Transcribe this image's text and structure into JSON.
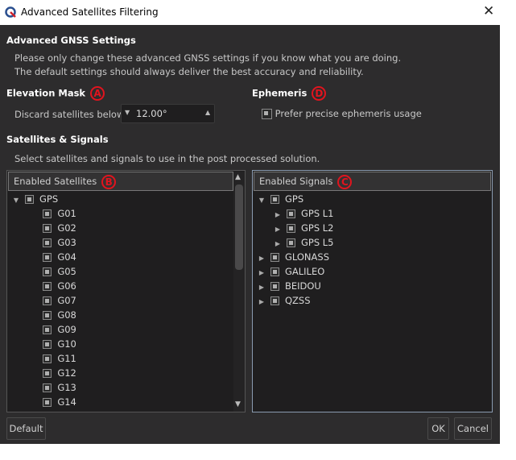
{
  "window": {
    "title": "Advanced Satellites Filtering",
    "close_icon": "close-icon",
    "app_icon": "q-logo-icon"
  },
  "gnss": {
    "heading": "Advanced GNSS Settings",
    "line1": "Please only change these advanced GNSS settings if you know what you are doing.",
    "line2": "The default settings should always deliver the best accuracy and reliability."
  },
  "elevation": {
    "heading": "Elevation Mask",
    "marker": "A",
    "label": "Discard satellites below:",
    "value": "12.00°"
  },
  "ephemeris": {
    "heading": "Ephemeris",
    "marker": "D",
    "checkbox_label": "Prefer precise ephemeris usage",
    "checked": "partial"
  },
  "sats_signals": {
    "heading": "Satellites & Signals",
    "description": "Select satellites and signals to use in the post processed solution."
  },
  "satellites": {
    "header": "Enabled Satellites",
    "marker": "B",
    "group": "GPS",
    "items": [
      "G01",
      "G02",
      "G03",
      "G04",
      "G05",
      "G06",
      "G07",
      "G08",
      "G09",
      "G10",
      "G11",
      "G12",
      "G13",
      "G14"
    ]
  },
  "signals": {
    "header": "Enabled Signals",
    "marker": "C",
    "gps": "GPS",
    "gps_children": [
      "GPS L1",
      "GPS L2",
      "GPS L5"
    ],
    "others": [
      "GLONASS",
      "GALILEO",
      "BEIDOU",
      "QZSS"
    ]
  },
  "buttons": {
    "default": "Default",
    "ok": "OK",
    "cancel": "Cancel"
  },
  "colors": {
    "marker": "#e0141e",
    "background": "#2d2c2d"
  }
}
